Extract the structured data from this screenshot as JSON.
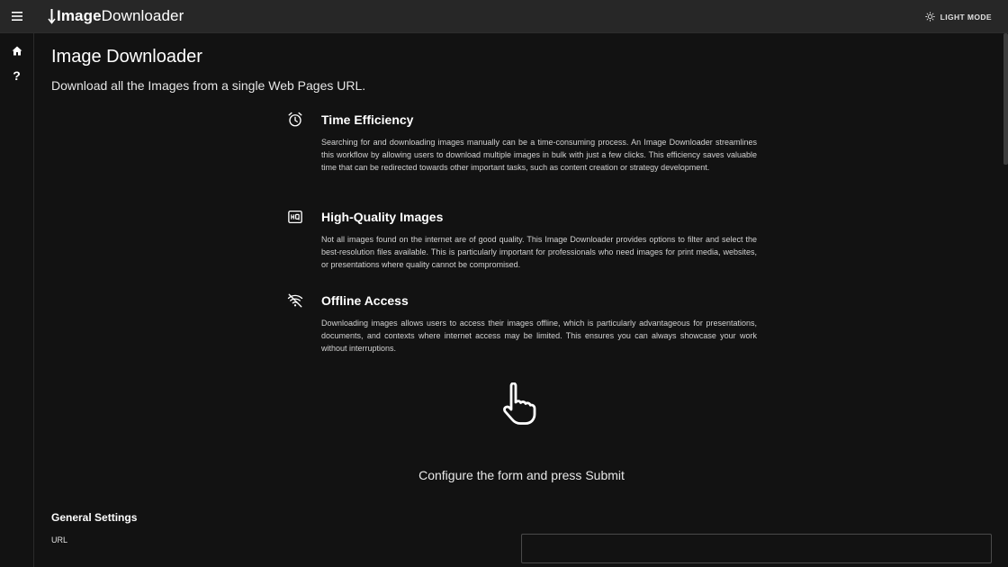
{
  "appbar": {
    "logo_part1": "Image",
    "logo_part2": "Downloader",
    "mode_label": "LIGHT MODE",
    "icons": {
      "menu": "hamburger-icon",
      "mode": "sun-icon"
    }
  },
  "sidebar": {
    "items": [
      {
        "name": "home",
        "icon": "home-icon"
      },
      {
        "name": "help",
        "icon": "question-icon",
        "glyph": "?"
      }
    ]
  },
  "main": {
    "title": "Image Downloader",
    "subtitle": "Download all the Images from a single Web Pages URL.",
    "features": [
      {
        "icon": "alarm-clock-icon",
        "title": "Time Efficiency",
        "text": "Searching for and downloading images manually can be a time-consuming process. An Image Downloader streamlines this workflow by allowing users to download multiple images in bulk with just a few clicks. This efficiency saves valuable time that can be redirected towards other important tasks, such as content creation or strategy development."
      },
      {
        "icon": "hq-icon",
        "title": "High-Quality Images",
        "text": "Not all images found on the internet are of good quality. This Image Downloader provides options to filter and select the best-resolution files available. This is particularly important for professionals who need images for print media, websites, or presentations where quality cannot be compromised."
      },
      {
        "icon": "wifi-off-icon",
        "title": "Offline Access",
        "text": "Downloading images allows users to access their images offline, which is particularly advantageous for presentations, documents, and contexts where internet access may be limited. This ensures you can always showcase your work without interruptions."
      }
    ],
    "pointer_icon": "pointing-hand-icon",
    "configure_text": "Configure the form and press Submit",
    "general_settings": {
      "title": "General Settings",
      "url_label": "URL",
      "url_value": ""
    }
  },
  "colors": {
    "background": "#121212",
    "appbar": "#272727",
    "text": "#ffffff",
    "muted_text": "#d2d2d2"
  }
}
